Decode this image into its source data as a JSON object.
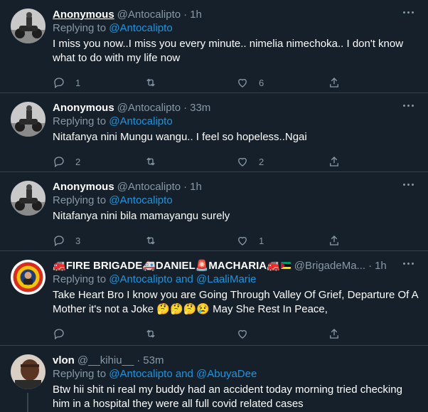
{
  "tweets": [
    {
      "name": "Anonymous",
      "handle": "@Antocalipto",
      "dot": "·",
      "time": "1h",
      "replying_prefix": "Replying to ",
      "replying_to": "@Antocalipto",
      "replying_extra": "",
      "text": "I miss you now..I miss you every minute.. nimelia nimechoka.. I don't know what to do with my life now",
      "replies": "1",
      "retweets": "",
      "likes": "6",
      "avatar": "motorcycle-photo"
    },
    {
      "name": "Anonymous",
      "handle": "@Antocalipto",
      "dot": "·",
      "time": "33m",
      "replying_prefix": "Replying to ",
      "replying_to": "@Antocalipto",
      "replying_extra": "",
      "text": "Nitafanya nini Mungu wangu.. I feel so hopeless..Ngai",
      "replies": "2",
      "retweets": "",
      "likes": "2",
      "avatar": "motorcycle-photo"
    },
    {
      "name": "Anonymous",
      "handle": "@Antocalipto",
      "dot": "·",
      "time": "1h",
      "replying_prefix": "Replying to ",
      "replying_to": "@Antocalipto",
      "replying_extra": "",
      "text": "Nitafanya nini bila mamayangu surely",
      "replies": "3",
      "retweets": "",
      "likes": "1",
      "avatar": "motorcycle-photo"
    },
    {
      "name_parts": [
        "FIRE BRIGADE",
        "DANIEL",
        "MACHARIA"
      ],
      "handle": "@BrigadeMa...",
      "dot": "·",
      "time": "1h",
      "replying_prefix": "Replying to ",
      "replying_to": "@Antocalipto",
      "replying_and": " and ",
      "replying_extra": "@LaaliMarie",
      "text": "Take Heart Bro I know you are Going Through Valley Of Grief, Departure Of A Mother it's not a Joke",
      "text_tail": "May She Rest In Peace,",
      "replies": "",
      "retweets": "",
      "likes": "",
      "avatar": "fire-brigade-badge"
    },
    {
      "name": "vlon",
      "handle": "@__kihiu__",
      "dot": "·",
      "time": "53m",
      "replying_prefix": "Replying to ",
      "replying_to": "@Antocalipto",
      "replying_and": " and ",
      "replying_extra": "@AbuyaDee",
      "text": "Btw hii shit ni real my buddy had an accident today morning tried checking him in a hospital they were all full covid related cases",
      "avatar": "person-photo"
    }
  ],
  "colors": {
    "background": "#15202b",
    "border": "#38444d",
    "muted": "#8899a6",
    "link": "#1b95e0"
  }
}
